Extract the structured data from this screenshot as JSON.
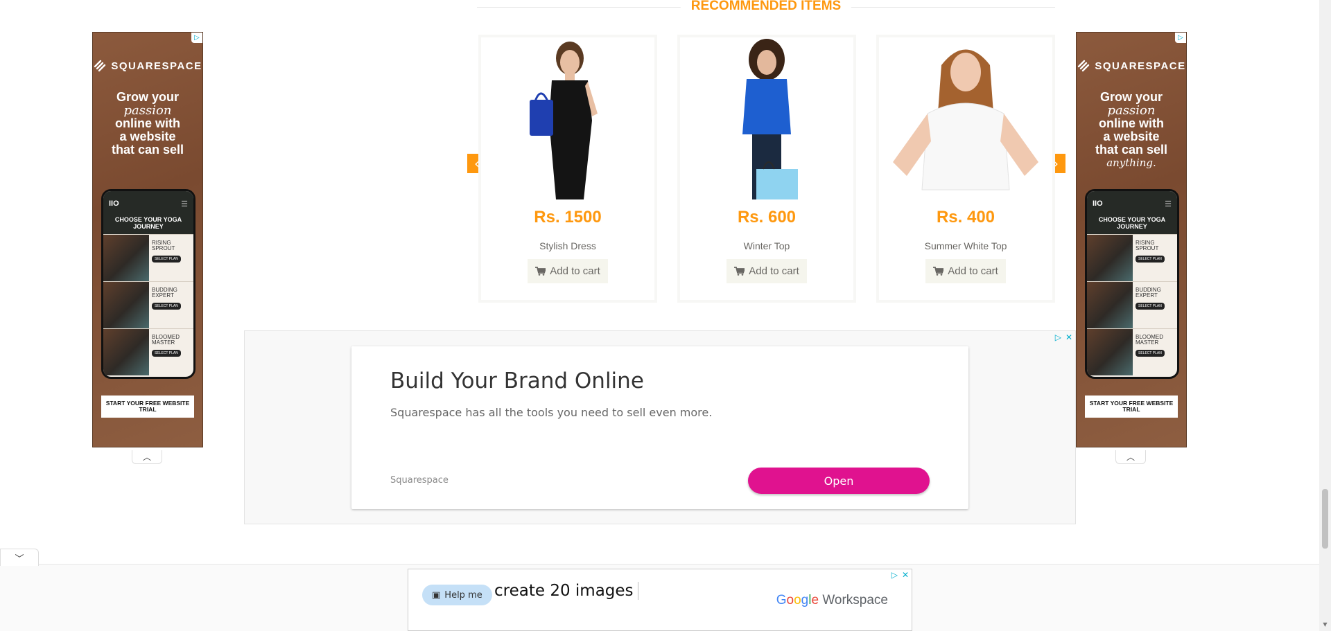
{
  "recommended": {
    "title": "RECOMMENDED ITEMS",
    "products": [
      {
        "price": "Rs. 1500",
        "name": "Stylish Dress",
        "cart_label": "Add to cart",
        "image": "woman-black-dress"
      },
      {
        "price": "Rs. 600",
        "name": "Winter Top",
        "cart_label": "Add to cart",
        "image": "woman-blue-top"
      },
      {
        "price": "Rs. 400",
        "name": "Summer White Top",
        "cart_label": "Add to cart",
        "image": "woman-white-top"
      }
    ],
    "prev_icon": "chevron-left-icon",
    "next_icon": "chevron-right-icon"
  },
  "side_ad": {
    "brand": "SQUARESPACE",
    "headline_lines": [
      "Grow your",
      "passion",
      "online with",
      "a website",
      "that can sell",
      "anything."
    ],
    "phone_header": "CHOOSE YOUR YOGA JOURNEY",
    "plans": [
      {
        "title": "RISING SPROUT",
        "button": "SELECT PLAN"
      },
      {
        "title": "BUDDING EXPERT",
        "button": "SELECT PLAN"
      },
      {
        "title": "BLOOMED MASTER",
        "button": "SELECT PLAN"
      }
    ],
    "cta": "START YOUR FREE WEBSITE TRIAL"
  },
  "middle_ad": {
    "title": "Build Your Brand Online",
    "subtitle": "Squarespace has all the tools you need to sell even more.",
    "advertiser": "Squarespace",
    "button": "Open"
  },
  "anchor_ad": {
    "help_label": "Help me",
    "text": "create 20 images",
    "brand_google": [
      "G",
      "o",
      "o",
      "g",
      "l",
      "e"
    ],
    "brand_product": "Workspace"
  },
  "colors": {
    "accent": "#fe980f",
    "ad_button": "#e0128f",
    "adchoices": "#00aecd"
  }
}
